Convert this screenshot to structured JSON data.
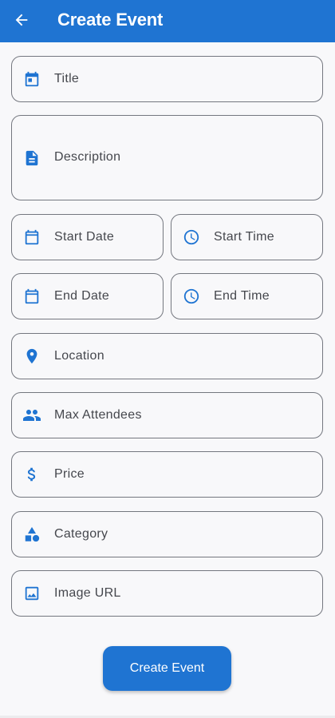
{
  "app_bar": {
    "title": "Create Event",
    "back_icon": "arrow-back-icon",
    "color": "#1f74d2"
  },
  "form": {
    "title": {
      "placeholder": "Title",
      "icon": "calendar-today-icon"
    },
    "description": {
      "placeholder": "Description",
      "icon": "description-icon"
    },
    "start_date": {
      "placeholder": "Start Date",
      "icon": "calendar-icon"
    },
    "start_time": {
      "placeholder": "Start Time",
      "icon": "clock-icon"
    },
    "end_date": {
      "placeholder": "End Date",
      "icon": "calendar-icon"
    },
    "end_time": {
      "placeholder": "End Time",
      "icon": "clock-icon"
    },
    "location": {
      "placeholder": "Location",
      "icon": "location-pin-icon"
    },
    "max_attendees": {
      "placeholder": "Max Attendees",
      "icon": "people-icon"
    },
    "price": {
      "placeholder": "Price",
      "icon": "dollar-icon"
    },
    "category": {
      "placeholder": "Category",
      "icon": "category-icon"
    },
    "image_url": {
      "placeholder": "Image URL",
      "icon": "image-icon"
    }
  },
  "submit": {
    "label": "Create Event"
  }
}
